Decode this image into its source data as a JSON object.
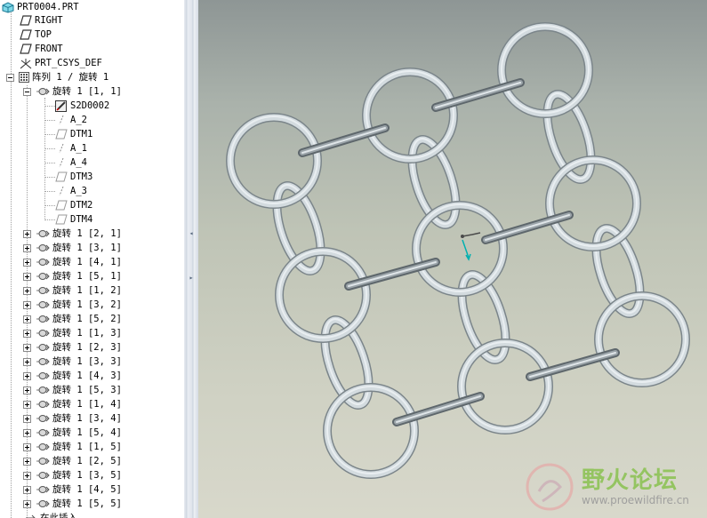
{
  "tree": {
    "root": {
      "label": "PRT0004.PRT",
      "icon": "part-icon"
    },
    "datum_planes": [
      "RIGHT",
      "TOP",
      "FRONT"
    ],
    "csys": "PRT_CSYS_DEF",
    "pattern": "阵列 1 / 旋转 1",
    "first_member": "旋转 1 [1, 1]",
    "first_member_children": [
      "S2D0002",
      "A_2",
      "DTM1",
      "A_1",
      "A_4",
      "DTM3",
      "A_3",
      "DTM2",
      "DTM4"
    ],
    "members": [
      "旋转 1 [2, 1]",
      "旋转 1 [3, 1]",
      "旋转 1 [4, 1]",
      "旋转 1 [5, 1]",
      "旋转 1 [1, 2]",
      "旋转 1 [3, 2]",
      "旋转 1 [5, 2]",
      "旋转 1 [1, 3]",
      "旋转 1 [2, 3]",
      "旋转 1 [3, 3]",
      "旋转 1 [4, 3]",
      "旋转 1 [5, 3]",
      "旋转 1 [1, 4]",
      "旋转 1 [3, 4]",
      "旋转 1 [5, 4]",
      "旋转 1 [1, 5]",
      "旋转 1 [2, 5]",
      "旋转 1 [3, 5]",
      "旋转 1 [4, 5]",
      "旋转 1 [5, 5]"
    ],
    "insert_here": "在此插入"
  },
  "watermark": {
    "text": "野火论坛",
    "url": "www.proewildfire.cn"
  },
  "colors": {
    "ring": "#d3dbdf",
    "ring_edge": "#7b858a",
    "axis": "#00b0b0"
  }
}
